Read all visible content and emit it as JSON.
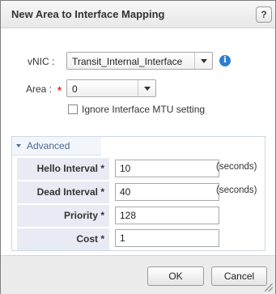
{
  "dialog": {
    "title": "New Area to Interface Mapping",
    "help_label": "?"
  },
  "form": {
    "vnic_label": "vNIC :",
    "vnic_value": "Transit_Internal_Interface",
    "area_label": "Area :",
    "area_required_marker": "*",
    "area_value": "0",
    "ignore_mtu_label": "Ignore Interface MTU setting",
    "ignore_mtu_checked": false
  },
  "advanced": {
    "header": "Advanced",
    "rows": [
      {
        "label": "Hello Interval *",
        "value": "10",
        "unit": "(seconds)"
      },
      {
        "label": "Dead Interval *",
        "value": "40",
        "unit": "(seconds)"
      },
      {
        "label": "Priority *",
        "value": "128",
        "unit": ""
      },
      {
        "label": "Cost *",
        "value": "1",
        "unit": ""
      }
    ]
  },
  "footer": {
    "ok_label": "OK",
    "cancel_label": "Cancel"
  },
  "colors": {
    "info_icon": "#2a7fd4",
    "required_star": "#d52b1e",
    "advanced_header_text": "#4f6a8f",
    "row_label_bg": "#e8ebf4"
  },
  "icons": {
    "help": "help-icon",
    "info": "info-icon",
    "dropdown": "chevron-down-icon",
    "expand": "triangle-down-icon",
    "resize": "resize-grip-icon"
  }
}
